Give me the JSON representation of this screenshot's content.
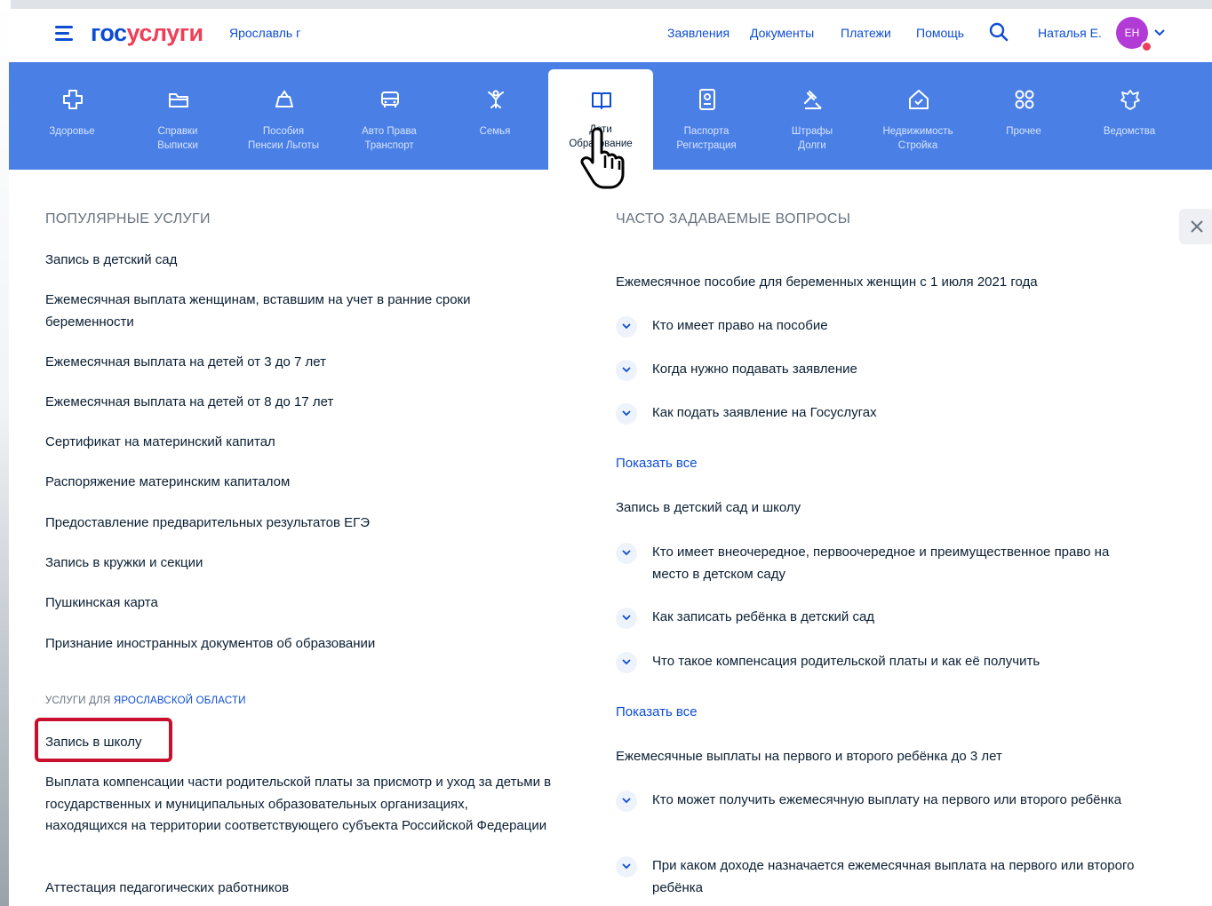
{
  "header": {
    "logo_part1": "гос",
    "logo_part2": "услуги",
    "city": "Ярославль г",
    "nav": [
      "Заявления",
      "Документы",
      "Платежи",
      "Помощь"
    ],
    "user_name": "Наталья Е.",
    "avatar_initials": "ЕН"
  },
  "categories": [
    {
      "label": "Здоровье",
      "icon": "health-icon"
    },
    {
      "label": "Справки\nВыписки",
      "icon": "folder-icon"
    },
    {
      "label": "Пособия\nПенсии Льготы",
      "icon": "benefits-icon"
    },
    {
      "label": "Авто Права\nТранспорт",
      "icon": "car-icon"
    },
    {
      "label": "Семья",
      "icon": "family-icon"
    },
    {
      "label": "Дети\nОбразование",
      "icon": "book-icon",
      "active": true
    },
    {
      "label": "Паспорта\nРегистрация",
      "icon": "passport-icon"
    },
    {
      "label": "Штрафы\nДолги",
      "icon": "gavel-icon"
    },
    {
      "label": "Недвижимость\nСтройка",
      "icon": "house-icon"
    },
    {
      "label": "Прочее",
      "icon": "grid-icon"
    },
    {
      "label": "Ведомства",
      "icon": "emblem-icon"
    }
  ],
  "popular": {
    "title": "ПОПУЛЯРНЫЕ УСЛУГИ",
    "items": [
      "Запись в детский сад",
      "Ежемесячная выплата женщинам, вставшим на учет в ранние сроки беременности",
      "Ежемесячная выплата на детей от 3 до 7 лет",
      "Ежемесячная выплата на детей от 8 до 17 лет",
      "Сертификат на материнский капитал",
      "Распоряжение материнским капиталом",
      "Предоставление предварительных результатов ЕГЭ",
      "Запись в кружки и секции",
      "Пушкинская карта",
      "Признание иностранных документов об образовании"
    ]
  },
  "regional": {
    "title_prefix": "УСЛУГИ ДЛЯ ",
    "title_region": "ЯРОСЛАВСКОЙ ОБЛАСТИ",
    "items": [
      "Запись в школу",
      "Выплата компенсации части родительской платы за присмотр и уход за детьми в государственных и муниципальных образовательных организациях, находящихся на территории соответствующего субъекта Российской Федерации",
      "Аттестация педагогических работников"
    ]
  },
  "faq": {
    "title": "ЧАСТО ЗАДАВАЕМЫЕ ВОПРОСЫ",
    "show_all": "Показать все",
    "groups": [
      {
        "heading": "Ежемесячное пособие для беременных женщин с 1 июля 2021 года",
        "questions": [
          "Кто имеет право на пособие",
          "Когда нужно подавать заявление",
          "Как подать заявление на Госуслугах"
        ]
      },
      {
        "heading": "Запись в детский сад и школу",
        "questions": [
          "Кто имеет внеочередное, первоочередное и преимущественное право на место в детском саду",
          "Как записать ребёнка в детский сад",
          "Что такое компенсация родительской платы и как её получить"
        ]
      },
      {
        "heading": "Ежемесячные выплаты на первого и второго ребёнка до 3 лет",
        "questions": [
          "Кто может получить ежемесячную выплату на первого или второго ребёнка",
          "При каком доходе назначается ежемесячная выплата на первого или второго ребёнка"
        ]
      }
    ]
  },
  "colors": {
    "brand_blue": "#0d4cd3",
    "brand_red": "#ee3f58",
    "category_bar": "#4a7fe6",
    "highlight": "#c8102e"
  }
}
